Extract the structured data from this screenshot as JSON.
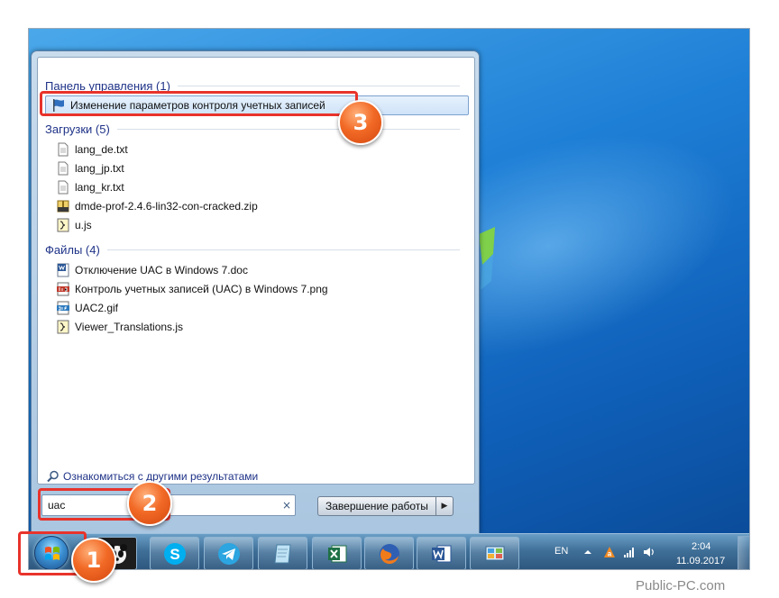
{
  "start_menu": {
    "groups": [
      {
        "title": "Панель управления (1)",
        "items": [
          {
            "label": "Изменение параметров контроля учетных записей",
            "icon": "flag-icon"
          }
        ]
      },
      {
        "title": "Загрузки (5)",
        "items": [
          {
            "label": "lang_de.txt",
            "icon": "text-file-icon"
          },
          {
            "label": "lang_jp.txt",
            "icon": "text-file-icon"
          },
          {
            "label": "lang_kr.txt",
            "icon": "text-file-icon"
          },
          {
            "label": "dmde-prof-2.4.6-lin32-con-cracked.zip",
            "icon": "zip-file-icon"
          },
          {
            "label": "u.js",
            "icon": "script-file-icon"
          }
        ]
      },
      {
        "title": "Файлы (4)",
        "items": [
          {
            "label": "Отключение UAC в Windows 7.doc",
            "icon": "word-file-icon"
          },
          {
            "label": "Контроль учетных записей (UAC) в Windows 7.png",
            "icon": "png-file-icon"
          },
          {
            "label": "UAC2.gif",
            "icon": "gif-file-icon"
          },
          {
            "label": "Viewer_Translations.js",
            "icon": "script-file-icon"
          }
        ]
      }
    ],
    "more_results": "Ознакомиться с другими результатами",
    "search": {
      "value": "uac",
      "clear_glyph": "×"
    },
    "shutdown_label": "Завершение работы",
    "shutdown_arrow_glyph": "▶"
  },
  "taskbar": {
    "pinned": [
      "panda-app-icon",
      "skype-icon",
      "telegram-icon",
      "notepad-icon",
      "excel-icon",
      "firefox-icon",
      "word-icon",
      "control-panel-icon"
    ],
    "tray": {
      "language": "EN",
      "time": "2:04",
      "date": "11.09.2017"
    }
  },
  "annotations": [
    "1",
    "2",
    "3"
  ],
  "watermark": "Public-PC.com",
  "colors": {
    "highlight": "#e8332b",
    "badge": "#f26a26",
    "link": "#1e3287",
    "taskbar": "#3f6f98"
  }
}
